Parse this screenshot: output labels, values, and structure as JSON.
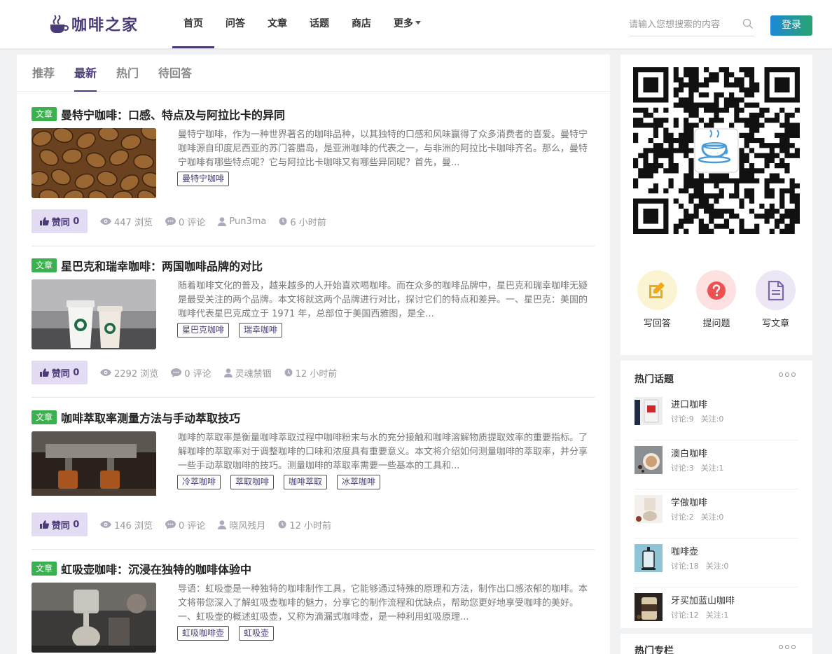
{
  "header": {
    "logo_text": "咖啡之家",
    "nav": [
      {
        "label": "首页",
        "active": true
      },
      {
        "label": "问答"
      },
      {
        "label": "文章"
      },
      {
        "label": "话题"
      },
      {
        "label": "商店"
      },
      {
        "label": "更多"
      }
    ],
    "search_placeholder": "请输入您想搜索的内容",
    "login_label": "登录"
  },
  "tabs": [
    {
      "label": "推荐"
    },
    {
      "label": "最新",
      "active": true
    },
    {
      "label": "热门"
    },
    {
      "label": "待回答"
    }
  ],
  "articles": [
    {
      "badge": "文章",
      "title": "曼特宁咖啡：口感、特点及与阿拉比卡的异同",
      "excerpt": "曼特宁咖啡，作为一种世界著名的咖啡品种，以其独特的口感和风味赢得了众多消费者的喜爱。曼特宁咖啡源自印度尼西亚的苏门答腊岛，是亚洲咖啡的代表之一，与非洲的阿拉比卡咖啡齐名。那么，曼特宁咖啡有哪些特点呢？它与阿拉比卡咖啡又有哪些异同呢？首先，曼...",
      "tags": [
        "曼特宁咖啡"
      ],
      "like_label": "赞同",
      "likes": "0",
      "views": "447 浏览",
      "comments": "0 评论",
      "author": "Pun3ma",
      "time": "6 小时前"
    },
    {
      "badge": "文章",
      "title": "星巴克和瑞幸咖啡：两国咖啡品牌的对比",
      "excerpt": "随着咖啡文化的普及，越来越多的人开始喜欢喝咖啡。而在众多的咖啡品牌中，星巴克和瑞幸咖啡无疑是最受关注的两个品牌。本文将就这两个品牌进行对比，探讨它们的特点和差异。一、星巴克：美国的咖啡代表星巴克成立于 1971 年，总部位于美国西雅图，是全...",
      "tags": [
        "星巴克咖啡",
        "瑞幸咖啡"
      ],
      "like_label": "赞同",
      "likes": "0",
      "views": "2292 浏览",
      "comments": "0 评论",
      "author": "灵魂禁锢",
      "time": "12 小时前"
    },
    {
      "badge": "文章",
      "title": "咖啡萃取率测量方法与手动萃取技巧",
      "excerpt": "咖啡的萃取率是衡量咖啡萃取过程中咖啡粉末与水的充分接触和咖啡溶解物质提取效率的重要指标。了解咖啡的萃取率对于调整咖啡的口味和浓度具有重要意义。本文将介绍如何测量咖啡的萃取率，并分享一些手动萃取咖啡的技巧。测量咖啡的萃取率需要一些基本的工具和...",
      "tags": [
        "冷萃咖啡",
        "萃取咖啡",
        "咖啡萃取",
        "冰萃咖啡"
      ],
      "like_label": "赞同",
      "likes": "0",
      "views": "146 浏览",
      "comments": "0 评论",
      "author": "晓风残月",
      "time": "12 小时前"
    },
    {
      "badge": "文章",
      "title": "虹吸壶咖啡：沉浸在独特的咖啡体验中",
      "excerpt": "导语：虹吸壶是一种独特的咖啡制作工具，它能够通过特殊的原理和方法，制作出口感浓郁的咖啡。本文将带您深入了解虹吸壶咖啡的魅力，分享它的制作流程和优缺点，帮助您更好地享受咖啡的美好。一、虹吸壶的概述虹吸壶，又称为滴漏式咖啡壶，是一种利用虹吸原理...",
      "tags": [
        "虹吸咖啡壶",
        "虹吸壶"
      ],
      "like_label": "",
      "likes": "",
      "views": "",
      "comments": "",
      "author": "",
      "time": ""
    }
  ],
  "sidebar": {
    "actions": [
      {
        "label": "写回答",
        "bg": "#fbf4d2",
        "fg": "#f0a818",
        "icon": "pencil-square-icon"
      },
      {
        "label": "提问题",
        "bg": "#fde0e0",
        "fg": "#ef5050",
        "icon": "question-circle-icon"
      },
      {
        "label": "写文章",
        "bg": "#ece6f5",
        "fg": "#7a66a8",
        "icon": "document-icon"
      }
    ],
    "hot_topics_title": "热门话题",
    "topics": [
      {
        "name": "进口咖啡",
        "discuss": "讨论:9",
        "follow": "关注:0"
      },
      {
        "name": "澳白咖啡",
        "discuss": "讨论:3",
        "follow": "关注:1"
      },
      {
        "name": "学做咖啡",
        "discuss": "讨论:2",
        "follow": "关注:0"
      },
      {
        "name": "咖啡壶",
        "discuss": "讨论:18",
        "follow": "关注:0"
      },
      {
        "name": "牙买加蓝山咖啡",
        "discuss": "讨论:12",
        "follow": "关注:1"
      }
    ],
    "hot_columns_title": "热门专栏"
  },
  "colors": {
    "brand": "#4b3a78",
    "badge_green": "#3bb04e",
    "like_bg": "#e4dcf3"
  }
}
